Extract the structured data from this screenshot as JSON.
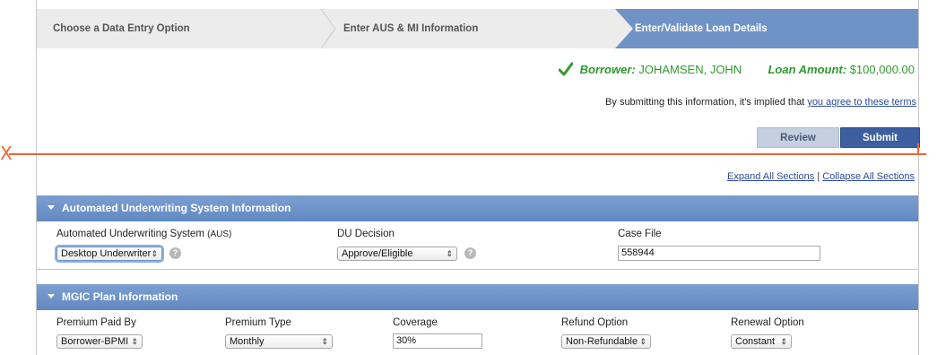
{
  "steps": {
    "step1": "Choose a Data Entry Option",
    "step2": "Enter AUS & MI Information",
    "step3": "Enter/Validate Loan Details"
  },
  "borrower": {
    "label": "Borrower:",
    "name": "JOHAMSEN, JOHN",
    "loan_label": "Loan Amount:",
    "loan_amount": "$100,000.00"
  },
  "terms": {
    "text": "By submitting this information, it's implied that",
    "link": "you agree to these terms"
  },
  "buttons": {
    "review": "Review",
    "submit": "Submit"
  },
  "sections_links": {
    "expand": "Expand All Sections",
    "separator": "|",
    "collapse": "Collapse All Sections"
  },
  "aus_section": {
    "title": "Automated Underwriting System Information",
    "aus_label": "Automated Underwriting System",
    "aus_suffix": "(AUS)",
    "aus_value": "Desktop Underwriter",
    "du_label": "DU Decision",
    "du_value": "Approve/Eligible",
    "case_label": "Case File",
    "case_value": "558944"
  },
  "mgic_section": {
    "title": "MGIC Plan Information",
    "premium_paid_label": "Premium Paid By",
    "premium_paid_value": "Borrower-BPMI",
    "premium_type_label": "Premium Type",
    "premium_type_value": "Monthly",
    "coverage_label": "Coverage",
    "coverage_value": "30%",
    "refund_label": "Refund Option",
    "refund_value": "Non-Refundable",
    "renewal_label": "Renewal Option",
    "renewal_value": "Constant"
  },
  "annotation": {
    "marker": "X",
    "color": "#e8663a"
  },
  "colors": {
    "header_blue": "#6f93c6",
    "submit_blue": "#3d5f9f",
    "green": "#2e9a2e"
  }
}
